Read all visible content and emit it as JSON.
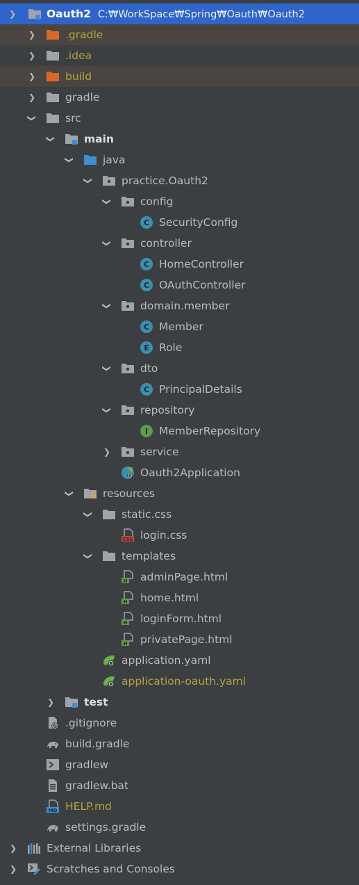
{
  "tree": {
    "rows": [
      {
        "label": "Oauth2",
        "path": "C:₩WorkSpace₩Spring₩Oauth₩Oauth2",
        "icon": "module-folder-icon",
        "expanded": true
      },
      {
        "label": ".gradle",
        "icon": "folder-excluded-icon",
        "expanded": false
      },
      {
        "label": ".idea",
        "icon": "folder-icon",
        "expanded": false
      },
      {
        "label": "build",
        "icon": "folder-excluded-icon",
        "expanded": false
      },
      {
        "label": "gradle",
        "icon": "folder-icon",
        "expanded": false
      },
      {
        "label": "src",
        "icon": "folder-icon",
        "expanded": true
      },
      {
        "label": "main",
        "icon": "source-root-folder-icon",
        "expanded": true
      },
      {
        "label": "java",
        "icon": "source-folder-icon",
        "expanded": true
      },
      {
        "label": "practice.Oauth2",
        "icon": "package-icon",
        "expanded": true
      },
      {
        "label": "config",
        "icon": "package-icon",
        "expanded": true
      },
      {
        "label": "SecurityConfig",
        "icon": "class-icon",
        "badge": "C"
      },
      {
        "label": "controller",
        "icon": "package-icon",
        "expanded": true
      },
      {
        "label": "HomeController",
        "icon": "class-icon",
        "badge": "C"
      },
      {
        "label": "OAuthController",
        "icon": "class-icon",
        "badge": "C"
      },
      {
        "label": "domain.member",
        "icon": "package-icon",
        "expanded": true
      },
      {
        "label": "Member",
        "icon": "class-icon",
        "badge": "C"
      },
      {
        "label": "Role",
        "icon": "enum-icon",
        "badge": "E"
      },
      {
        "label": "dto",
        "icon": "package-icon",
        "expanded": true
      },
      {
        "label": "PrincipalDetails",
        "icon": "class-icon",
        "badge": "C"
      },
      {
        "label": "repository",
        "icon": "package-icon",
        "expanded": true
      },
      {
        "label": "MemberRepository",
        "icon": "interface-icon",
        "badge": "I"
      },
      {
        "label": "service",
        "icon": "package-icon",
        "expanded": false
      },
      {
        "label": "Oauth2Application",
        "icon": "spring-boot-application-icon"
      },
      {
        "label": "resources",
        "icon": "resources-folder-icon",
        "expanded": true
      },
      {
        "label": "static.css",
        "icon": "folder-icon",
        "expanded": true
      },
      {
        "label": "login.css",
        "icon": "css-file-icon",
        "badge": "CSS"
      },
      {
        "label": "templates",
        "icon": "folder-icon",
        "expanded": true
      },
      {
        "label": "adminPage.html",
        "icon": "html-file-icon",
        "badge": "H"
      },
      {
        "label": "home.html",
        "icon": "html-file-icon",
        "badge": "H"
      },
      {
        "label": "loginForm.html",
        "icon": "html-file-icon",
        "badge": "H"
      },
      {
        "label": "privatePage.html",
        "icon": "html-file-icon",
        "badge": "H"
      },
      {
        "label": "application.yaml",
        "icon": "spring-config-icon"
      },
      {
        "label": "application-oauth.yaml",
        "icon": "spring-config-icon"
      },
      {
        "label": "test",
        "icon": "test-root-folder-icon",
        "expanded": false
      },
      {
        "label": ".gitignore",
        "icon": "gitignore-file-icon"
      },
      {
        "label": "build.gradle",
        "icon": "gradle-elephant-icon"
      },
      {
        "label": "gradlew",
        "icon": "shell-script-icon"
      },
      {
        "label": "gradlew.bat",
        "icon": "text-file-icon"
      },
      {
        "label": "HELP.md",
        "icon": "markdown-file-icon",
        "badge": "MD"
      },
      {
        "label": "settings.gradle",
        "icon": "gradle-elephant-icon"
      },
      {
        "label": "External Libraries",
        "icon": "libraries-icon",
        "expanded": false
      },
      {
        "label": "Scratches and Consoles",
        "icon": "scratches-icon",
        "expanded": false
      }
    ]
  },
  "colors": {
    "background": "#3c3f41",
    "selection": "#2f65ca",
    "excluded_row": "#4a4540",
    "folder_gray": "#a0a4a8",
    "folder_orange": "#d9692a",
    "folder_blue": "#3d8fd6",
    "class_teal": "#3c8fb0",
    "interface_green": "#5f9b4c",
    "modified_text": "#b4a33a"
  }
}
